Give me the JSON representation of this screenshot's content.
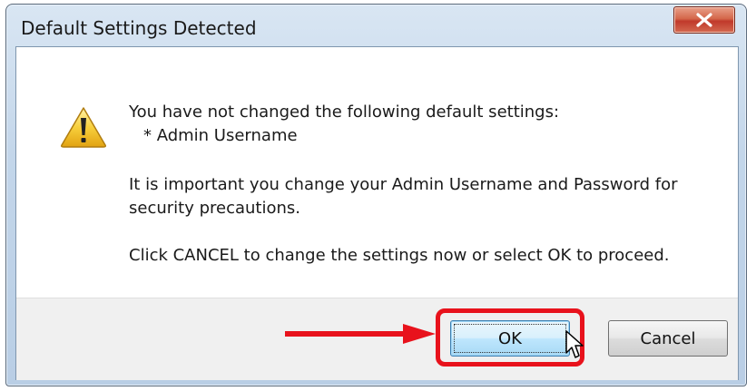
{
  "window": {
    "title": "Default Settings Detected",
    "close_icon": "close-x-icon"
  },
  "message": {
    "icon": "warning-icon",
    "line1": "You have not changed the following default settings:",
    "line2": "* Admin Username",
    "line3": "It is important you change your Admin Username and Password for",
    "line4": "security precautions.",
    "line5": "Click CANCEL to change the settings now or select OK to proceed."
  },
  "buttons": {
    "ok_label": "OK",
    "cancel_label": "Cancel"
  },
  "annotation": {
    "highlight_color": "#e8121c",
    "arrow_color": "#e8121c"
  }
}
